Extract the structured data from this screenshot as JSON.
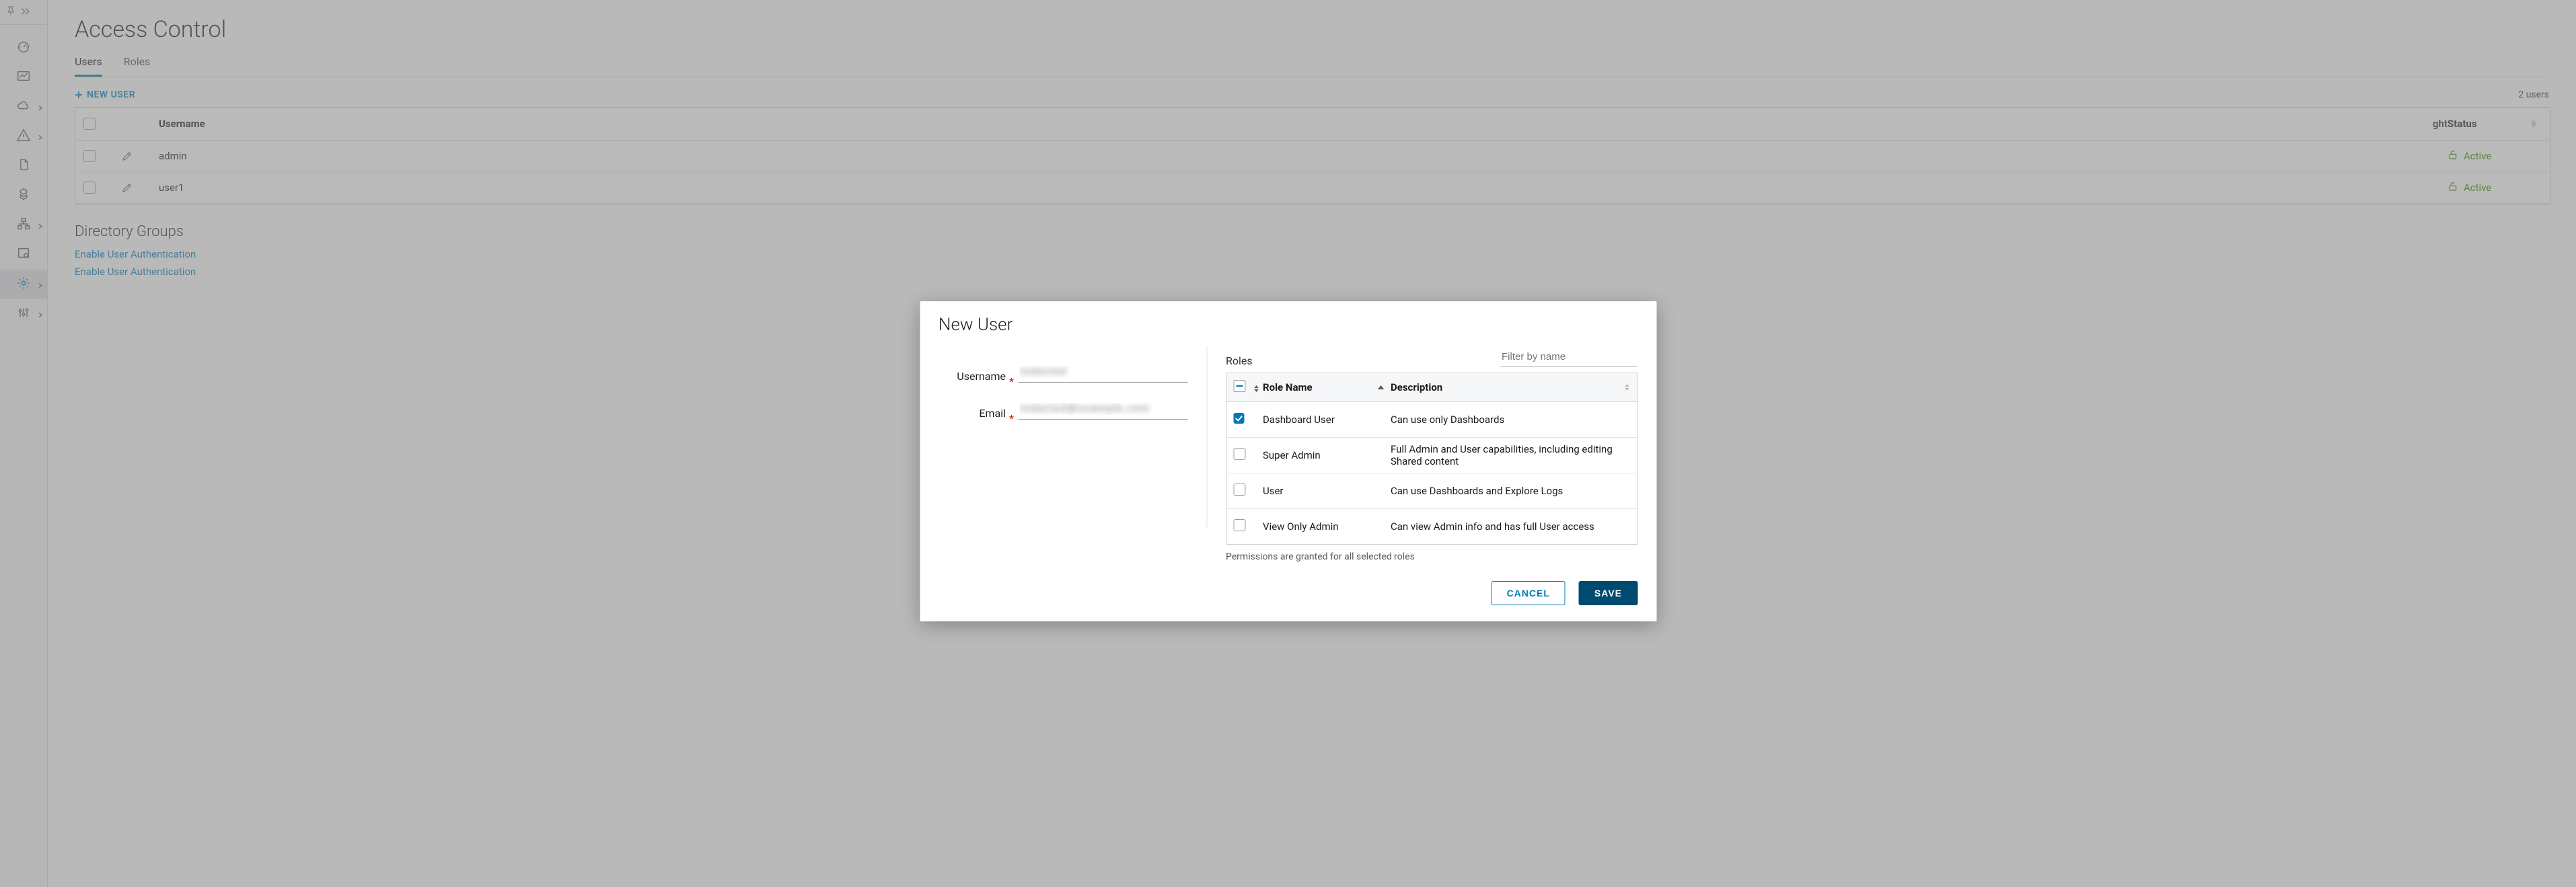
{
  "sidebar": {
    "items": [
      {
        "name": "dashboard-icon"
      },
      {
        "name": "chart-icon"
      },
      {
        "name": "cloud-icon",
        "chevron": true
      },
      {
        "name": "alert-icon",
        "chevron": true
      },
      {
        "name": "document-icon"
      },
      {
        "name": "objects-icon"
      },
      {
        "name": "topology-icon",
        "chevron": true
      },
      {
        "name": "config-icon"
      },
      {
        "name": "settings-icon",
        "chevron": true,
        "active": true
      },
      {
        "name": "sliders-icon",
        "chevron": true
      }
    ]
  },
  "page": {
    "title": "Access Control",
    "tabs": [
      {
        "label": "Users",
        "active": true
      },
      {
        "label": "Roles",
        "active": false
      }
    ],
    "new_user_label": "NEW USER",
    "count_label": "2 users",
    "table": {
      "headers": {
        "username": "Username",
        "status": "Status",
        "extra": "ght"
      },
      "rows": [
        {
          "username": "admin",
          "status": "Active"
        },
        {
          "username": "user1",
          "status": "Active"
        }
      ]
    },
    "section_title": "Directory Groups",
    "links": [
      "Enable User Authentication",
      "Enable User Authentication"
    ]
  },
  "modal": {
    "title": "New User",
    "fields": {
      "username_label": "Username",
      "username_value": "redacted",
      "email_label": "Email",
      "email_value": "redacted@example.com"
    },
    "roles_label": "Roles",
    "filter_placeholder": "Filter by name",
    "roles_table": {
      "headers": {
        "name": "Role Name",
        "description": "Description"
      },
      "rows": [
        {
          "checked": true,
          "name": "Dashboard User",
          "description": "Can use only Dashboards"
        },
        {
          "checked": false,
          "name": "Super Admin",
          "description": "Full Admin and User capabilities, including editing Shared content"
        },
        {
          "checked": false,
          "name": "User",
          "description": "Can use Dashboards and Explore Logs"
        },
        {
          "checked": false,
          "name": "View Only Admin",
          "description": "Can view Admin info and has full User access"
        }
      ]
    },
    "hint": "Permissions are granted for all selected roles",
    "cancel_label": "CANCEL",
    "save_label": "SAVE"
  }
}
